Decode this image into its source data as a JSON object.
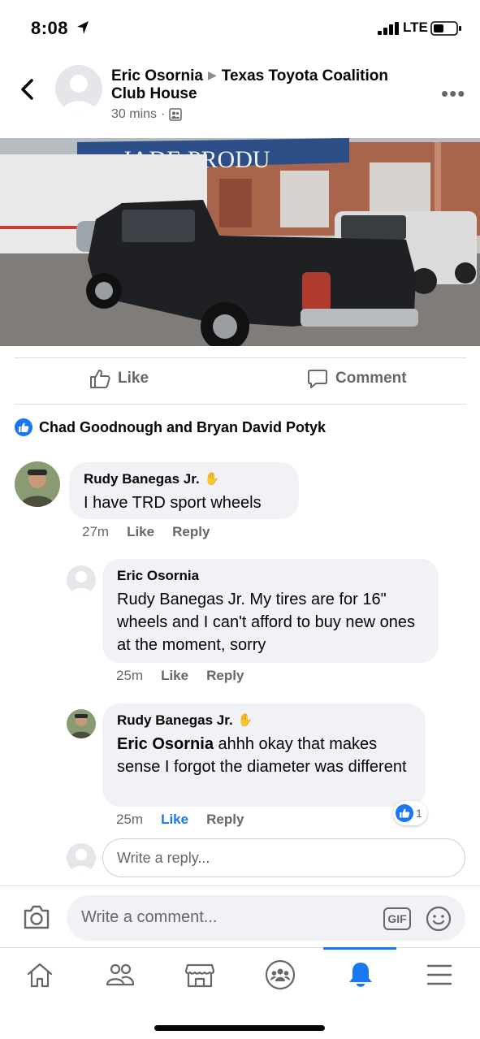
{
  "status_bar": {
    "time": "8:08",
    "network": "LTE"
  },
  "post": {
    "author": "Eric Osornia",
    "group_line1": "Texas Toyota Coalition",
    "group_line2": "Club House",
    "time": "30 mins",
    "separator": "·",
    "photo_sign_text": "JADE PRODU"
  },
  "actions": {
    "like": "Like",
    "comment": "Comment"
  },
  "reactions": {
    "names": "Chad Goodnough and Bryan David Potyk"
  },
  "comments": [
    {
      "name": "Rudy Banegas Jr.",
      "text": "I have TRD sport wheels",
      "time": "27m",
      "like": "Like",
      "reply": "Reply"
    },
    {
      "name": "Eric Osornia",
      "text": "Rudy Banegas Jr. My tires are for 16\" wheels and I can't afford to buy new ones at the moment, sorry",
      "time": "25m",
      "like": "Like",
      "reply": "Reply"
    },
    {
      "name": "Rudy Banegas Jr.",
      "mention": "Eric Osornia",
      "text": " ahhh okay that makes sense I forgot the diameter was different",
      "time": "25m",
      "like": "Like",
      "reply": "Reply",
      "reaction_count": "1"
    }
  ],
  "reply_placeholder": "Write a reply...",
  "composer": {
    "placeholder": "Write a comment...",
    "gif": "GIF"
  },
  "tabs": [
    "home-icon",
    "friends-icon",
    "marketplace-icon",
    "groups-icon",
    "notifications-icon",
    "menu-icon"
  ],
  "colors": {
    "accent": "#1877f2",
    "bubble": "#f0f2f5",
    "secondary_text": "#65676b"
  }
}
